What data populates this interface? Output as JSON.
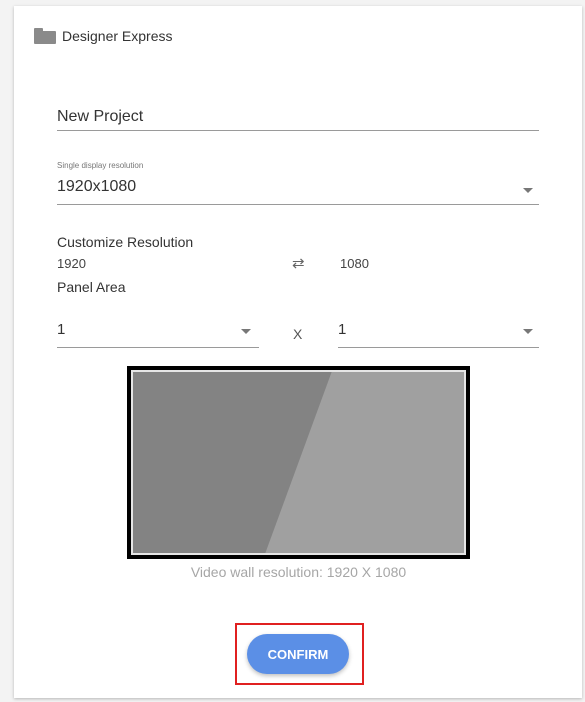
{
  "app": {
    "title": "Designer Express",
    "icon": "folder-icon"
  },
  "project": {
    "name_value": "New Project"
  },
  "resolution": {
    "label": "Single display resolution",
    "selected": "1920x1080"
  },
  "customize": {
    "label": "Customize Resolution",
    "width": "1920",
    "swap_symbol": "⇄",
    "height": "1080"
  },
  "panel_area": {
    "label": "Panel Area",
    "columns": "1",
    "separator": "X",
    "rows": "1"
  },
  "preview": {
    "caption": "Video wall resolution: 1920 X 1080",
    "colors": {
      "frame": "#000000",
      "panel_left": "#838383",
      "panel_right": "#a0a0a0",
      "border": "#e6e6e6"
    }
  },
  "actions": {
    "confirm_label": "CONFIRM",
    "accent": "#5b8fe6",
    "highlight": "#e02020"
  }
}
